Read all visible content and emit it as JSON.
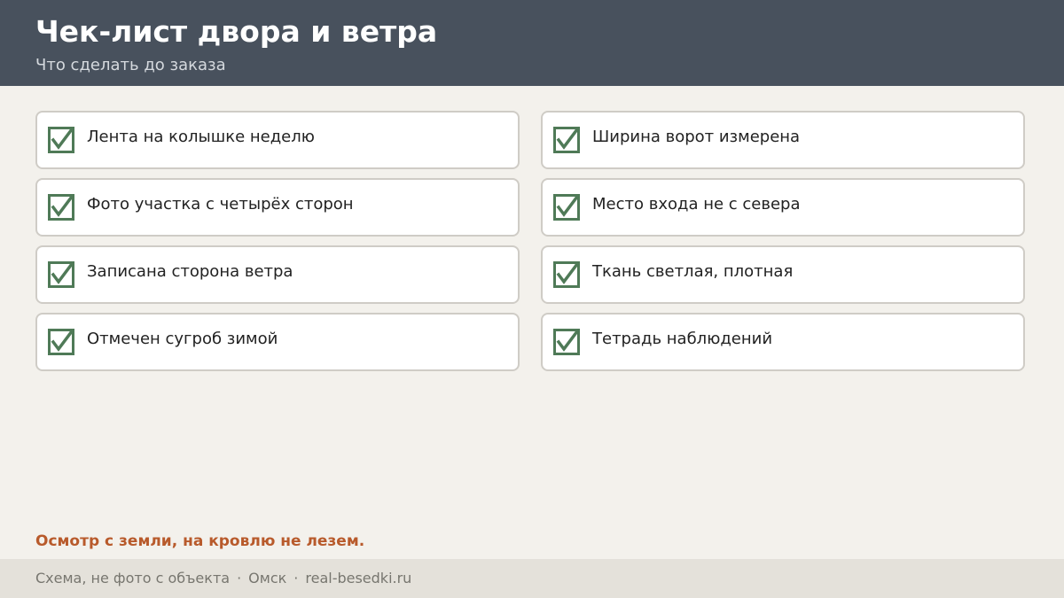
{
  "header": {
    "title": "Чек-лист двора и ветра",
    "subtitle": "Что сделать до заказа"
  },
  "checklist": {
    "check_color": "#4f7a57",
    "left": [
      {
        "label": "Лента на колышке неделю",
        "checked": true
      },
      {
        "label": "Фото участка с четырёх сторон",
        "checked": true
      },
      {
        "label": "Записана сторона ветра",
        "checked": true
      },
      {
        "label": "Отмечен сугроб зимой",
        "checked": true
      }
    ],
    "right": [
      {
        "label": "Ширина ворот измерена",
        "checked": true
      },
      {
        "label": "Место входа не с севера",
        "checked": true
      },
      {
        "label": "Ткань светлая, плотная",
        "checked": true
      },
      {
        "label": "Тетрадь наблюдений",
        "checked": true
      }
    ]
  },
  "note": {
    "text": "Осмотр с земли, на кровлю не лезем.",
    "color": "#b85a2b"
  },
  "footer": {
    "parts": [
      "Схема, не фото с объекта",
      "Омск",
      "real-besedki.ru"
    ],
    "separator": "·"
  }
}
